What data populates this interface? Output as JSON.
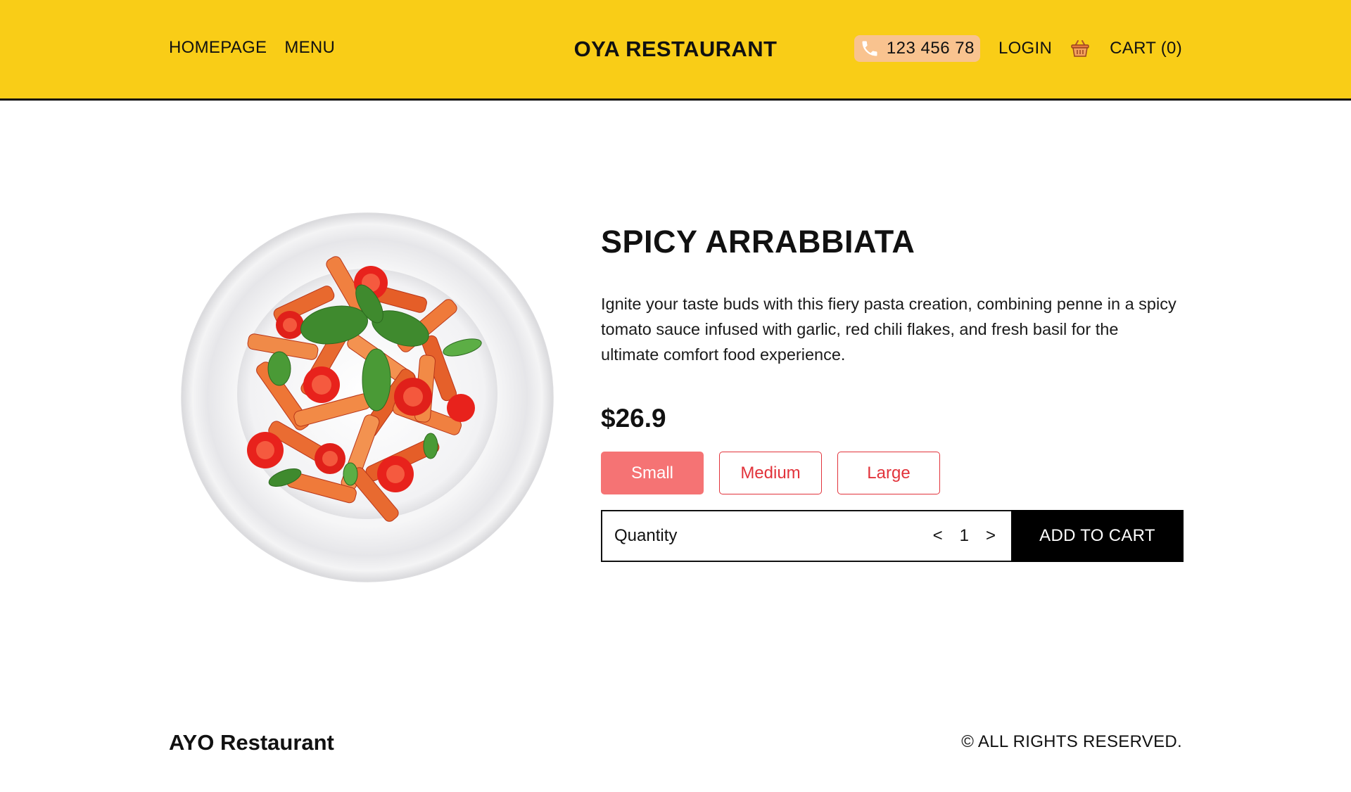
{
  "header": {
    "nav": [
      {
        "label": "HOMEPAGE"
      },
      {
        "label": "MENU"
      }
    ],
    "brand": "OYA RESTAURANT",
    "phone": {
      "icon": "phone-icon",
      "number": "123 456 78"
    },
    "login_label": "LOGIN",
    "cart": {
      "icon": "basket-icon",
      "label": "CART (0)"
    },
    "colors": {
      "background": "#f9cd17",
      "phone_pill": "#f9c38f"
    }
  },
  "product": {
    "title": "SPICY ARRABBIATA",
    "description": "Ignite your taste buds with this fiery pasta creation, combining penne in a spicy tomato sauce infused with garlic, red chili flakes, and fresh basil for the ultimate comfort food experience.",
    "price": "$26.9",
    "sizes": [
      {
        "label": "Small",
        "selected": true
      },
      {
        "label": "Medium",
        "selected": false
      },
      {
        "label": "Large",
        "selected": false
      }
    ],
    "quantity_label": "Quantity",
    "quantity_value": "1",
    "decrement_label": "<",
    "increment_label": ">",
    "add_to_cart_label": "ADD TO CART",
    "colors": {
      "size_active": "#f57374",
      "size_outline": "#e2333b"
    }
  },
  "footer": {
    "brand": "AYO Restaurant",
    "copyright": "© ALL RIGHTS RESERVED."
  }
}
